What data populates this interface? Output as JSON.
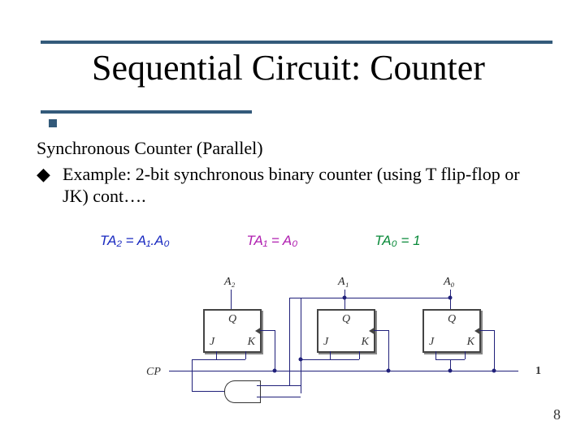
{
  "title": "Sequential Circuit: Counter",
  "subtitle": "Synchronous Counter (Parallel)",
  "bullet": "Example: 2-bit synchronous binary counter (using T flip-flop or JK) cont….",
  "equations": {
    "ta2": "TA₂ = A₁.A₀",
    "ta1": "TA₁ = A₀",
    "ta0": "TA₀ = 1"
  },
  "diagram": {
    "flipflops": [
      {
        "output": "A₂",
        "top": "Q",
        "inL": "J",
        "inR": "K"
      },
      {
        "output": "A₁",
        "top": "Q",
        "inL": "J",
        "inR": "K"
      },
      {
        "output": "A₀",
        "top": "Q",
        "inL": "J",
        "inR": "K"
      }
    ],
    "clock_label": "CP",
    "constant_label": "1"
  },
  "slide_number": "8"
}
